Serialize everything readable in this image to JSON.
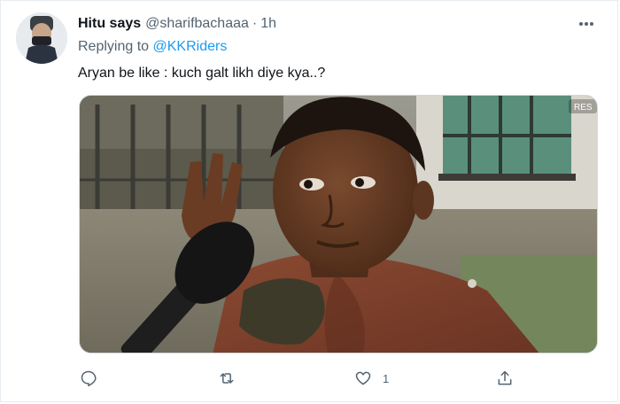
{
  "tweet": {
    "author_name": "Hitu says",
    "handle": "@sharifbachaaa",
    "separator": "·",
    "time": "1h",
    "replying_prefix": "Replying to",
    "replying_to": "@KKRiders",
    "text": "Aryan be like : kuch galt likh diye kya..?",
    "media_watermark": "RES"
  },
  "actions": {
    "reply_icon": "comment-icon",
    "retweet_icon": "retweet-icon",
    "like_icon": "heart-icon",
    "like_count": "1",
    "share_icon": "share-icon"
  },
  "colors": {
    "link": "#1d9bf0",
    "secondary_text": "#536471",
    "primary_text": "#0f1419"
  }
}
